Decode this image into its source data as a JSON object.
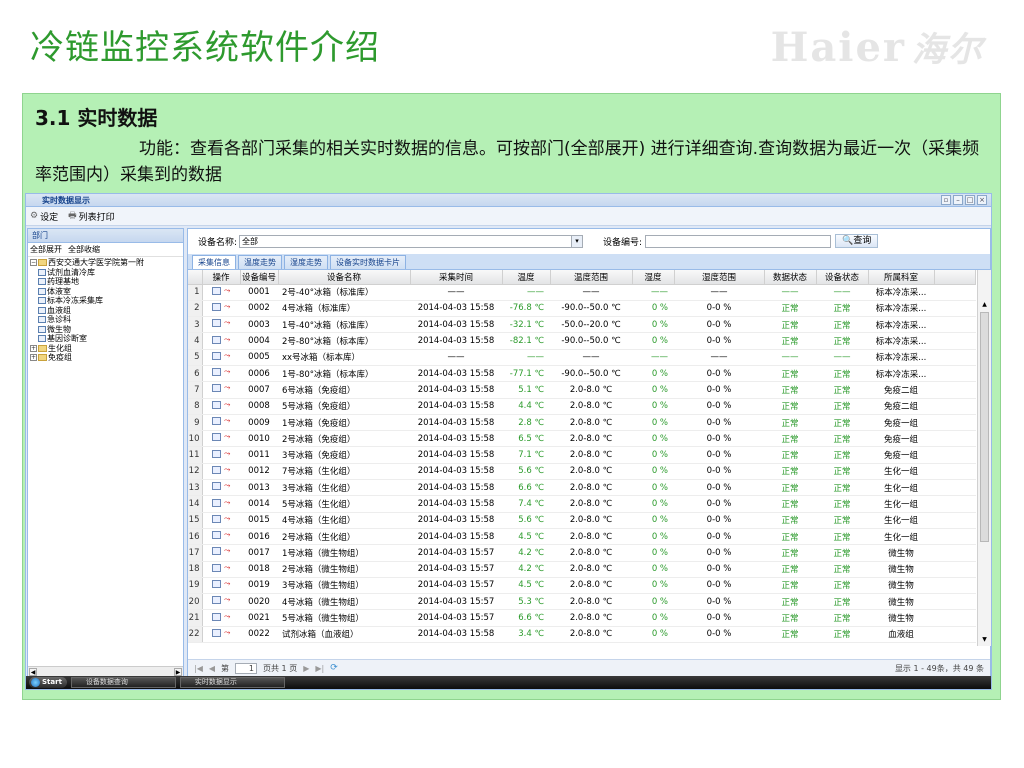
{
  "slide": {
    "title": "冷链监控系统软件介绍",
    "logo_latin": "Haier",
    "logo_cn": "海尔",
    "section_title": "3.1  实时数据",
    "description": "功能：查看各部门采集的相关实时数据的信息。可按部门(全部展开) 进行详细查询.查询数据为最近一次（采集频率范围内）采集到的数据"
  },
  "app": {
    "window_title": "实时数据显示",
    "toolbar": {
      "settings": "设定",
      "print": "列表打印"
    },
    "left": {
      "header": "部门",
      "expand_all": "全部展开",
      "collapse_all": "全部收缩",
      "tree": [
        {
          "label": "西安交通大学医学院第一附",
          "level": 0,
          "type": "folder",
          "toggle": "−"
        },
        {
          "label": "试剂血清冷库",
          "level": 1,
          "type": "doc"
        },
        {
          "label": "药理基地",
          "level": 1,
          "type": "doc"
        },
        {
          "label": "体液室",
          "level": 1,
          "type": "doc"
        },
        {
          "label": "标本冷冻采集库",
          "level": 1,
          "type": "doc"
        },
        {
          "label": "血液组",
          "level": 1,
          "type": "doc"
        },
        {
          "label": "急诊科",
          "level": 1,
          "type": "doc"
        },
        {
          "label": "微生物",
          "level": 1,
          "type": "doc"
        },
        {
          "label": "基因诊断室",
          "level": 1,
          "type": "doc"
        },
        {
          "label": "生化组",
          "level": 0,
          "type": "folder",
          "toggle": "+"
        },
        {
          "label": "免疫组",
          "level": 0,
          "type": "folder",
          "toggle": "+"
        }
      ]
    },
    "search": {
      "name_label": "设备名称:",
      "name_value": "全部",
      "number_label": "设备编号:",
      "number_value": "",
      "query_button": "查询"
    },
    "tabs": [
      "采集信息",
      "温度走势",
      "湿度走势",
      "设备实时数据卡片"
    ],
    "columns": [
      "",
      "操作",
      "设备编号",
      "设备名称",
      "采集时间",
      "温度",
      "温度范围",
      "湿度",
      "湿度范围",
      "数据状态",
      "设备状态",
      "所属科室"
    ],
    "rows": [
      [
        "1",
        "0001",
        "2号-40°冰箱（标准库）",
        "——",
        "——",
        "——",
        "——",
        "——",
        "——",
        "——",
        "标本冷冻采..."
      ],
      [
        "2",
        "0002",
        "4号冰箱（标准库）",
        "2014-04-03 15:58",
        "-76.8 ℃",
        "-90.0--50.0 ℃",
        "0 %",
        "0-0 %",
        "正常",
        "正常",
        "标本冷冻采..."
      ],
      [
        "3",
        "0003",
        "1号-40°冰箱（标准库）",
        "2014-04-03 15:58",
        "-32.1 ℃",
        "-50.0--20.0 ℃",
        "0 %",
        "0-0 %",
        "正常",
        "正常",
        "标本冷冻采..."
      ],
      [
        "4",
        "0004",
        "2号-80°冰箱（标本库）",
        "2014-04-03 15:58",
        "-82.1 ℃",
        "-90.0--50.0 ℃",
        "0 %",
        "0-0 %",
        "正常",
        "正常",
        "标本冷冻采..."
      ],
      [
        "5",
        "0005",
        "xx号冰箱（标本库）",
        "——",
        "——",
        "——",
        "——",
        "——",
        "——",
        "——",
        "标本冷冻采..."
      ],
      [
        "6",
        "0006",
        "1号-80°冰箱（标本库）",
        "2014-04-03 15:58",
        "-77.1 ℃",
        "-90.0--50.0 ℃",
        "0 %",
        "0-0 %",
        "正常",
        "正常",
        "标本冷冻采..."
      ],
      [
        "7",
        "0007",
        "6号冰箱（免疫组）",
        "2014-04-03 15:58",
        "5.1 ℃",
        "2.0-8.0 ℃",
        "0 %",
        "0-0 %",
        "正常",
        "正常",
        "免疫二组"
      ],
      [
        "8",
        "0008",
        "5号冰箱（免疫组）",
        "2014-04-03 15:58",
        "4.4 ℃",
        "2.0-8.0 ℃",
        "0 %",
        "0-0 %",
        "正常",
        "正常",
        "免疫二组"
      ],
      [
        "9",
        "0009",
        "1号冰箱（免疫组）",
        "2014-04-03 15:58",
        "2.8 ℃",
        "2.0-8.0 ℃",
        "0 %",
        "0-0 %",
        "正常",
        "正常",
        "免疫一组"
      ],
      [
        "10",
        "0010",
        "2号冰箱（免疫组）",
        "2014-04-03 15:58",
        "6.5 ℃",
        "2.0-8.0 ℃",
        "0 %",
        "0-0 %",
        "正常",
        "正常",
        "免疫一组"
      ],
      [
        "11",
        "0011",
        "3号冰箱（免疫组）",
        "2014-04-03 15:58",
        "7.1 ℃",
        "2.0-8.0 ℃",
        "0 %",
        "0-0 %",
        "正常",
        "正常",
        "免疫一组"
      ],
      [
        "12",
        "0012",
        "7号冰箱（生化组）",
        "2014-04-03 15:58",
        "5.6 ℃",
        "2.0-8.0 ℃",
        "0 %",
        "0-0 %",
        "正常",
        "正常",
        "生化一组"
      ],
      [
        "13",
        "0013",
        "3号冰箱（生化组）",
        "2014-04-03 15:58",
        "6.6 ℃",
        "2.0-8.0 ℃",
        "0 %",
        "0-0 %",
        "正常",
        "正常",
        "生化一组"
      ],
      [
        "14",
        "0014",
        "5号冰箱（生化组）",
        "2014-04-03 15:58",
        "7.4 ℃",
        "2.0-8.0 ℃",
        "0 %",
        "0-0 %",
        "正常",
        "正常",
        "生化一组"
      ],
      [
        "15",
        "0015",
        "4号冰箱（生化组）",
        "2014-04-03 15:58",
        "5.6 ℃",
        "2.0-8.0 ℃",
        "0 %",
        "0-0 %",
        "正常",
        "正常",
        "生化一组"
      ],
      [
        "16",
        "0016",
        "2号冰箱（生化组）",
        "2014-04-03 15:58",
        "4.5 ℃",
        "2.0-8.0 ℃",
        "0 %",
        "0-0 %",
        "正常",
        "正常",
        "生化一组"
      ],
      [
        "17",
        "0017",
        "1号冰箱（微生物组）",
        "2014-04-03 15:57",
        "4.2 ℃",
        "2.0-8.0 ℃",
        "0 %",
        "0-0 %",
        "正常",
        "正常",
        "微生物"
      ],
      [
        "18",
        "0018",
        "2号冰箱（微生物组）",
        "2014-04-03 15:57",
        "4.2 ℃",
        "2.0-8.0 ℃",
        "0 %",
        "0-0 %",
        "正常",
        "正常",
        "微生物"
      ],
      [
        "19",
        "0019",
        "3号冰箱（微生物组）",
        "2014-04-03 15:57",
        "4.5 ℃",
        "2.0-8.0 ℃",
        "0 %",
        "0-0 %",
        "正常",
        "正常",
        "微生物"
      ],
      [
        "20",
        "0020",
        "4号冰箱（微生物组）",
        "2014-04-03 15:57",
        "5.3 ℃",
        "2.0-8.0 ℃",
        "0 %",
        "0-0 %",
        "正常",
        "正常",
        "微生物"
      ],
      [
        "21",
        "0021",
        "5号冰箱（微生物组）",
        "2014-04-03 15:57",
        "6.6 ℃",
        "2.0-8.0 ℃",
        "0 %",
        "0-0 %",
        "正常",
        "正常",
        "微生物"
      ],
      [
        "22",
        "0022",
        "试剂冰箱（血液组）",
        "2014-04-03 15:58",
        "3.4 ℃",
        "2.0-8.0 ℃",
        "0 %",
        "0-0 %",
        "正常",
        "正常",
        "血液组"
      ]
    ],
    "pager": {
      "page_prefix": "第",
      "page_value": "1",
      "page_suffix": "页共 1 页",
      "display_info": "显示 1 - 49条，共 49 条"
    },
    "taskbar": {
      "start": "Start",
      "items": [
        "设备数据查询",
        "实时数据显示"
      ]
    },
    "colors": {
      "title_green": "#2e9a2e",
      "box_green": "#b5f0b5",
      "value_green": "#2a9a2a"
    }
  }
}
